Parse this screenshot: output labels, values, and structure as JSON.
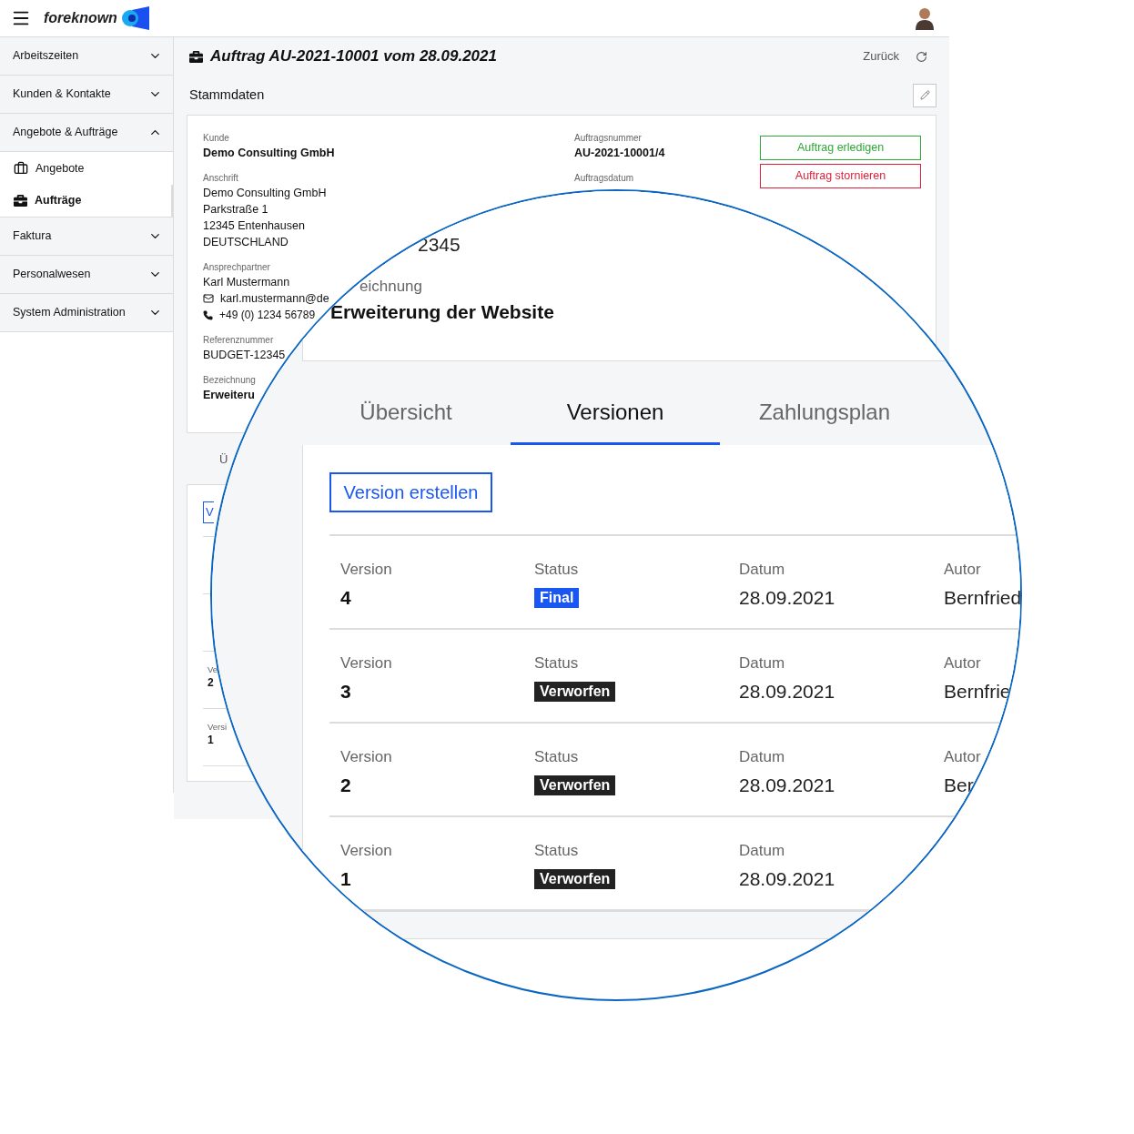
{
  "header": {
    "logo_text": "foreknown"
  },
  "sidebar": {
    "groups": [
      {
        "label": "Arbeitszeiten",
        "expanded": false
      },
      {
        "label": "Kunden & Kontakte",
        "expanded": false
      },
      {
        "label": "Angebote & Aufträge",
        "expanded": true,
        "children": [
          {
            "label": "Angebote",
            "selected": false
          },
          {
            "label": "Aufträge",
            "selected": true
          }
        ]
      },
      {
        "label": "Faktura",
        "expanded": false
      },
      {
        "label": "Personalwesen",
        "expanded": false
      },
      {
        "label": "System Administration",
        "expanded": false
      }
    ]
  },
  "page": {
    "title": "Auftrag AU-2021-10001 vom 28.09.2021",
    "back_label": "Zurück",
    "section_title": "Stammdaten"
  },
  "master_data": {
    "left": [
      {
        "label": "Kunde",
        "lines": [
          {
            "kind": "bold",
            "text": "Demo Consulting GmbH"
          }
        ]
      },
      {
        "label": "Anschrift",
        "lines": [
          {
            "kind": "text",
            "text": "Demo Consulting GmbH"
          },
          {
            "kind": "text",
            "text": "Parkstraße 1"
          },
          {
            "kind": "text",
            "text": "12345 Entenhausen"
          },
          {
            "kind": "text",
            "text": "DEUTSCHLAND"
          }
        ]
      },
      {
        "label": "Ansprechpartner",
        "lines": [
          {
            "kind": "text",
            "text": "Karl Mustermann"
          },
          {
            "kind": "email",
            "text": "karl.mustermann@de"
          },
          {
            "kind": "phone",
            "text": "+49 (0) 1234 56789"
          }
        ]
      },
      {
        "label": "Referenznummer",
        "lines": [
          {
            "kind": "text",
            "text": "BUDGET-12345"
          }
        ]
      },
      {
        "label": "Bezeichnung",
        "lines": [
          {
            "kind": "bold",
            "text": "Erweiteru"
          }
        ]
      }
    ],
    "right": [
      {
        "label": "Auftragsnummer",
        "value": "AU-2021-10001/4"
      },
      {
        "label": "Auftragsdatum"
      }
    ],
    "actions": [
      {
        "label": "Auftrag erledigen",
        "color": "#2ea836"
      },
      {
        "label": "Auftrag stornieren",
        "color": "#e0203a"
      }
    ]
  },
  "versions_small": {
    "tab": "Ü",
    "create_button": "V",
    "rows": [
      {
        "label": "Ve",
        "value": "2"
      },
      {
        "label": "Versi",
        "value": "1"
      }
    ]
  },
  "magnifier": {
    "card": {
      "reference": "2345",
      "label": "eichnung",
      "title": "Erweiterung der Website"
    },
    "tabs": [
      {
        "label": "Übersicht",
        "selected": false
      },
      {
        "label": "Versionen",
        "selected": true
      },
      {
        "label": "Zahlungsplan",
        "selected": false
      }
    ],
    "create_button": "Version erstellen",
    "rows": [
      {
        "cells": [
          {
            "label": "Version",
            "value": "4",
            "kind": "number"
          },
          {
            "label": "Status",
            "value": "Final",
            "kind": "badge",
            "color": "#1a56f0"
          },
          {
            "label": "Datum",
            "value": "28.09.2021",
            "kind": "text"
          },
          {
            "label": "Autor",
            "value": "Bernfried",
            "kind": "text"
          }
        ]
      },
      {
        "cells": [
          {
            "label": "Version",
            "value": "3",
            "kind": "number"
          },
          {
            "label": "Status",
            "value": "Verworfen",
            "kind": "badge",
            "color": "#222222"
          },
          {
            "label": "Datum",
            "value": "28.09.2021",
            "kind": "text"
          },
          {
            "label": "Autor",
            "value": "Bernfrie",
            "kind": "text"
          }
        ]
      },
      {
        "cells": [
          {
            "label": "Version",
            "value": "2",
            "kind": "number"
          },
          {
            "label": "Status",
            "value": "Verworfen",
            "kind": "badge",
            "color": "#222222"
          },
          {
            "label": "Datum",
            "value": "28.09.2021",
            "kind": "text"
          },
          {
            "label": "Autor",
            "value": "Ber",
            "kind": "text"
          }
        ]
      },
      {
        "cells": [
          {
            "label": "Version",
            "value": "1",
            "kind": "number"
          },
          {
            "label": "Status",
            "value": "Verworfen",
            "kind": "badge",
            "color": "#222222"
          },
          {
            "label": "Datum",
            "value": "28.09.2021",
            "kind": "text"
          }
        ]
      }
    ]
  }
}
